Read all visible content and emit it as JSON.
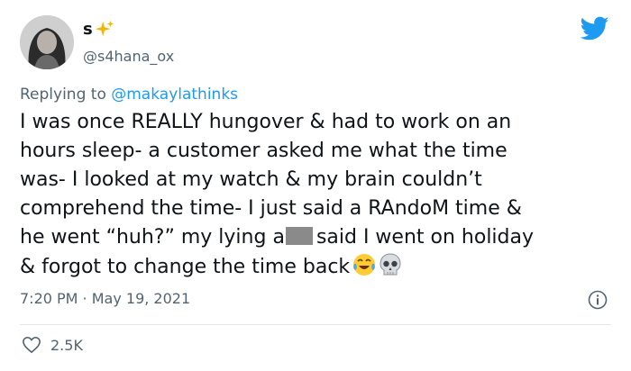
{
  "author": {
    "display_name": "s",
    "handle": "@s4hana_ox"
  },
  "reply": {
    "prefix": "Replying to",
    "mention": "@makaylathinks"
  },
  "tweet": {
    "line1": "I was once REALLY hungover & had to work on an",
    "line2": "hours sleep- a customer asked me what the time",
    "line3": "was- I looked at my watch & my brain couldn’t",
    "line4": "comprehend the time- I just said a RAndoM time &",
    "line5a": "he went “huh?” my lying a",
    "line5b": "said I went on holiday",
    "line6": "& forgot to change the time back"
  },
  "meta": {
    "timestamp": "7:20 PM · May 19, 2021"
  },
  "engagement": {
    "likes": "2.5K"
  },
  "icons": {
    "brand": "twitter-bird-icon",
    "sparkle": "sparkles-icon",
    "info": "info-icon",
    "like": "heart-icon",
    "emoji1": "tears-of-joy-emoji",
    "emoji2": "skull-emoji"
  },
  "colors": {
    "accent": "#1d9bf0",
    "text": "#0f1419",
    "secondary": "#536471"
  }
}
